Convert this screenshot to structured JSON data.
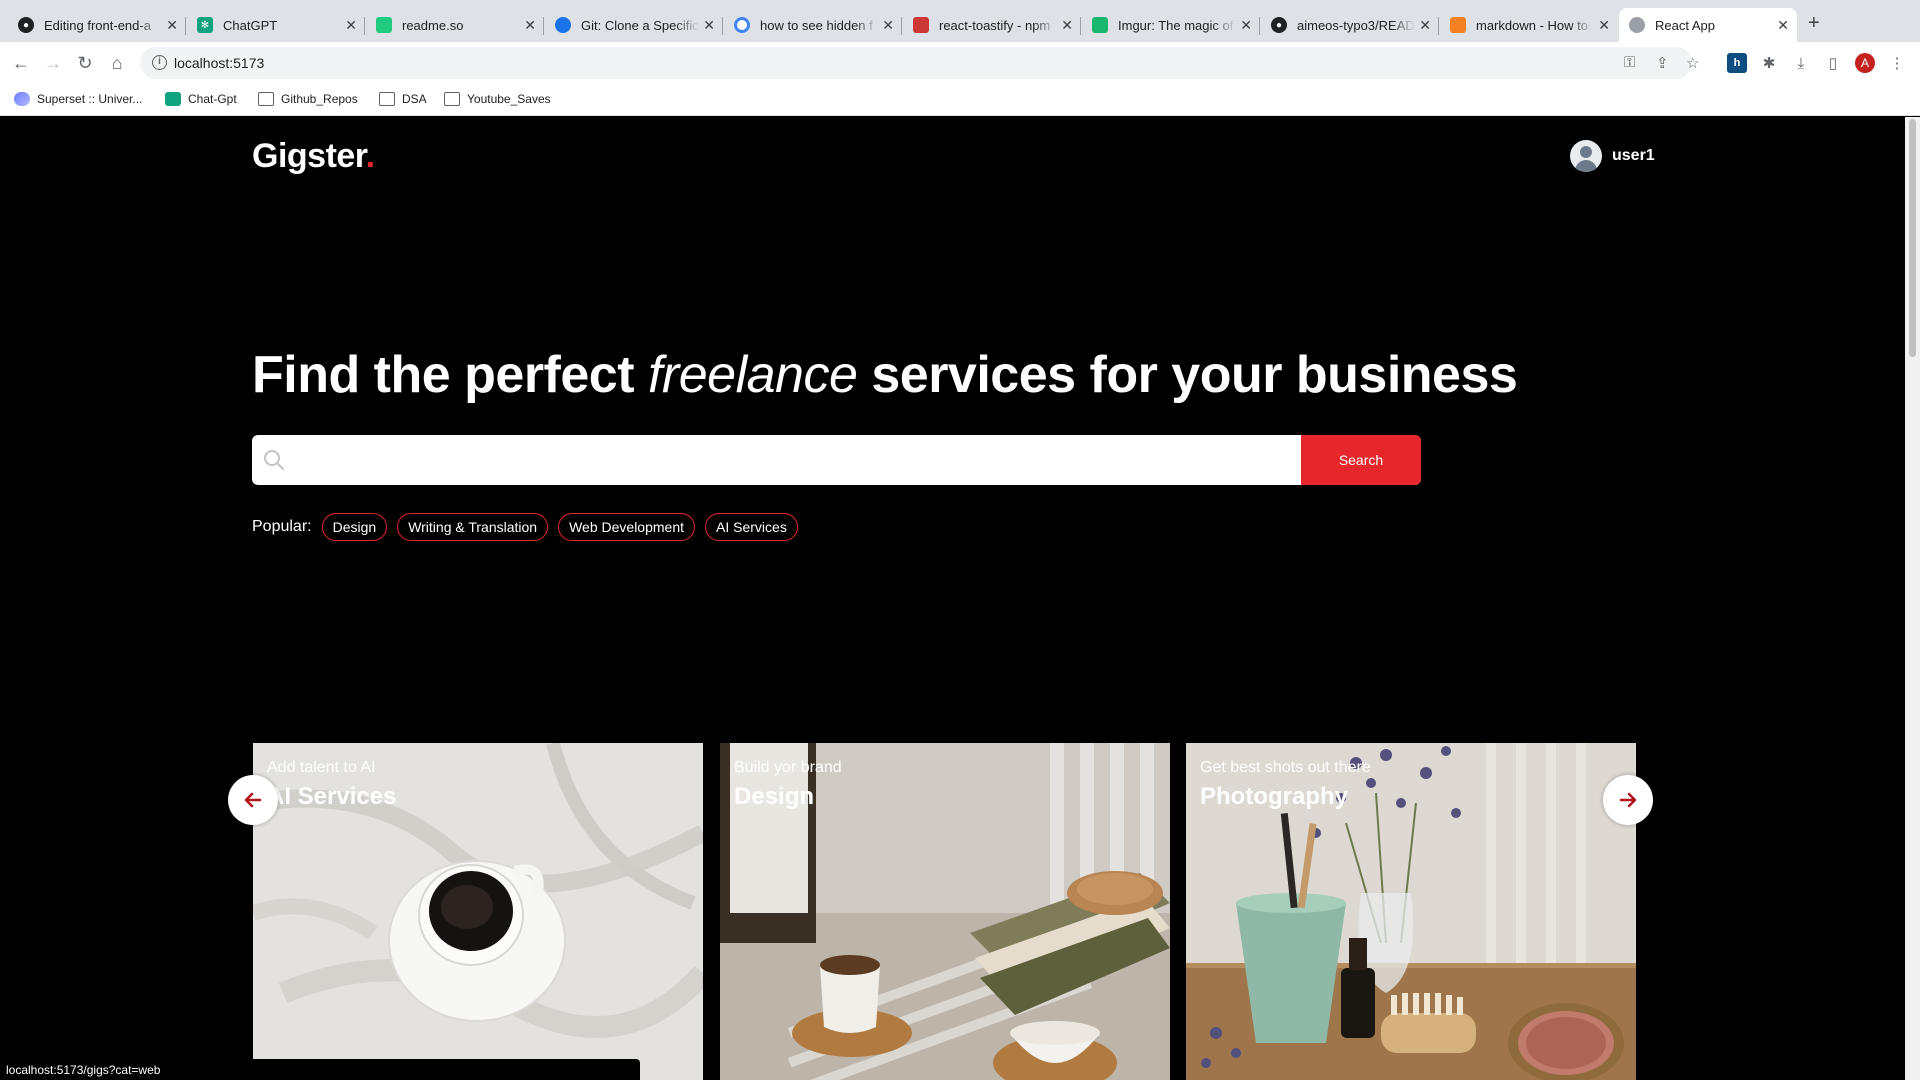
{
  "browser": {
    "tabs": [
      {
        "title": "Editing front-end-a",
        "icon": "github-icon",
        "color": "#202124"
      },
      {
        "title": "ChatGPT",
        "icon": "chatgpt-icon",
        "color": "#10a37f"
      },
      {
        "title": "readme.so",
        "icon": "readme-icon",
        "color": "#1ecb7f"
      },
      {
        "title": "Git: Clone a Specific",
        "icon": "globe-icon",
        "color": "#1a73e8"
      },
      {
        "title": "how to see hidden f",
        "icon": "google-icon",
        "color": "#4285f4"
      },
      {
        "title": "react-toastify - npm",
        "icon": "npm-icon",
        "color": "#cb3837"
      },
      {
        "title": "Imgur: The magic of",
        "icon": "imgur-icon",
        "color": "#1bb76e"
      },
      {
        "title": "aimeos-typo3/READ",
        "icon": "github-icon",
        "color": "#202124"
      },
      {
        "title": "markdown - How to",
        "icon": "stackoverflow-icon",
        "color": "#f48024"
      },
      {
        "title": "React App",
        "icon": "globe-icon",
        "color": "#9aa0a6"
      }
    ],
    "url": "localhost:5173",
    "profile_initial": "A",
    "bookmarks": [
      {
        "label": "Superset :: Univer...",
        "icon": "superset-icon"
      },
      {
        "label": "Chat-Gpt",
        "icon": "chatgpt-icon"
      },
      {
        "label": "Github_Repos",
        "icon": "folder-icon"
      },
      {
        "label": "DSA",
        "icon": "folder-icon"
      },
      {
        "label": "Youtube_Saves",
        "icon": "folder-icon"
      }
    ],
    "status_url": "localhost:5173/gigs?cat=web"
  },
  "navbar": {
    "logo": "Gigster",
    "logo_dot": ".",
    "username": "user1"
  },
  "hero": {
    "title_start": "Find the perfect ",
    "title_em": "freelance",
    "title_end": " services for your business",
    "search_placeholder": "",
    "search_button": "Search",
    "popular_label": "Popular:",
    "popular_tags": [
      "Design",
      "Writing & Translation",
      "Web Development",
      "AI Services"
    ]
  },
  "slides": [
    {
      "subtitle": "Add talent to AI",
      "title": "AI Services"
    },
    {
      "subtitle": "Build yor brand",
      "title": "Design"
    },
    {
      "subtitle": "Get best shots out there",
      "title": "Photography"
    }
  ],
  "colors": {
    "accent": "#e5262b",
    "background": "#000000"
  }
}
